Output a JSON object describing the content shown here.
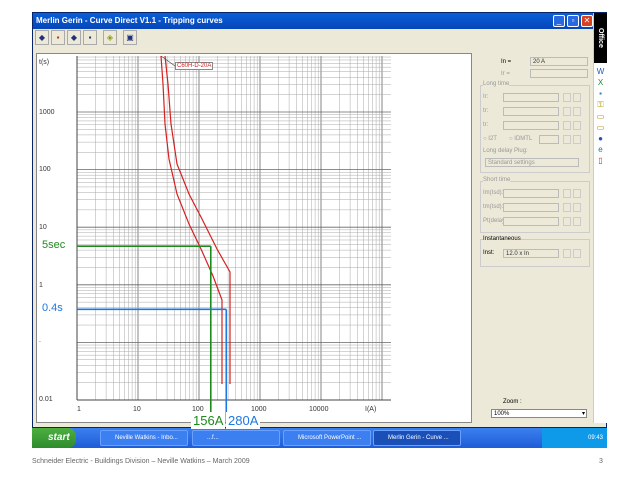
{
  "window": {
    "title": "Merlin Gerin - Curve Direct V1.1 - Tripping curves",
    "controls": [
      "_",
      "▫",
      "✕"
    ]
  },
  "toolbar": {
    "icons": [
      "curve-tool-1",
      "curve-tool-2",
      "curve-tool-3",
      "curve-tool-4",
      "print",
      "exit"
    ]
  },
  "plot": {
    "y_axis_label": "t(s)",
    "x_axis_label": "I(A)",
    "y_ticks": [
      "1000",
      "100",
      "10",
      "1",
      ".",
      "0.01"
    ],
    "x_ticks": [
      "1",
      "10",
      "100",
      "1000",
      "10000"
    ],
    "curve_label": "C60H-D-20A",
    "curve_color": "#d42020",
    "markers": [
      {
        "label": "5sec",
        "time_s": 5,
        "color": "#1e8a1e"
      },
      {
        "label": "0.4s",
        "time_s": 0.4,
        "color": "#1e78e0"
      }
    ],
    "currents": [
      {
        "label": "156A",
        "current_a": 156,
        "color": "#1e8a1e"
      },
      {
        "label": "280A",
        "current_a": 280,
        "color": "#1e78e0"
      }
    ]
  },
  "panel": {
    "in_label": "In =",
    "in_value": "20 A",
    "ir_label": "Ir =",
    "longtime": "Long time",
    "ir2": "Ir:",
    "tr": "tr:",
    "tr2": "tr:",
    "i2t": "I2T",
    "idmtl": "IDMTL",
    "plug_label": "Long delay Plug:",
    "plug_value": "Standard settings",
    "shorttime": "Short time",
    "isd1": "Im(Isd):",
    "isd2": "tm(tsd):",
    "i2t_delay": "Pt(delay):",
    "instantaneous": "Instantaneous",
    "inst_label": "Inst:",
    "inst_value": "12.0 x In",
    "zoom_label": "Zoom :",
    "zoom_value": "100%"
  },
  "office_bar": {
    "title": "Office"
  },
  "taskbar": {
    "start": "start",
    "tasks": [
      "Neville Watkins - Inbo...",
      "...f...",
      "Microsoft PowerPoint ...",
      "Merlin Gerin - Curve ..."
    ],
    "clock": "09:43"
  },
  "footer": {
    "text": "Schneider Electric - Buildings Division – Neville Watkins – March 2009",
    "page": "3"
  }
}
